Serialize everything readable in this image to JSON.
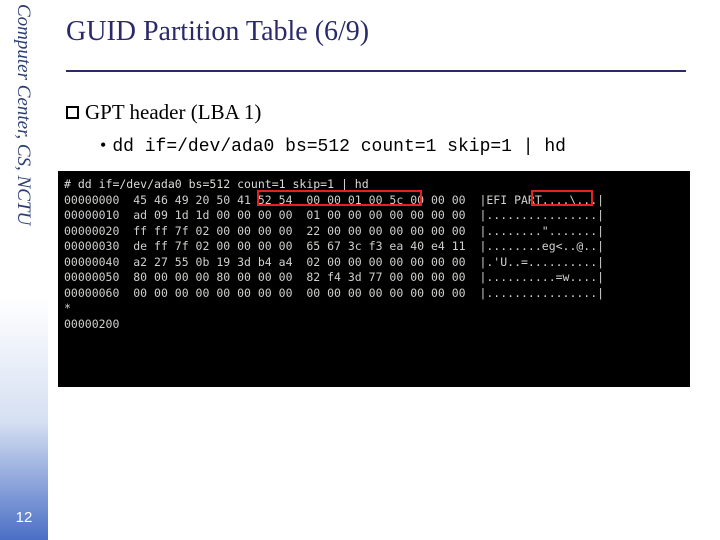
{
  "sidebar": {
    "org_text": "Computer Center, CS, NCTU",
    "page_number": "12"
  },
  "slide": {
    "title": "GUID Partition Table (6/9)",
    "section_heading": "GPT header (LBA 1)",
    "command": "dd if=/dev/ada0 bs=512 count=1 skip=1 | hd"
  },
  "hexdump": {
    "prompt": "# dd if=/dev/ada0 bs=512 count=1 skip=1 | hd",
    "rows": [
      {
        "off": "00000000",
        "hex": "45 46 49 20 50 41 52 54  00 00 01 00 5c 00 00 00",
        "ascii": "|EFI PART....\\...|"
      },
      {
        "off": "00000010",
        "hex": "ad 09 1d 1d 00 00 00 00  01 00 00 00 00 00 00 00",
        "ascii": "|................|"
      },
      {
        "off": "00000020",
        "hex": "ff ff 7f 02 00 00 00 00  22 00 00 00 00 00 00 00",
        "ascii": "|........\".......|"
      },
      {
        "off": "00000030",
        "hex": "de ff 7f 02 00 00 00 00  65 67 3c f3 ea 40 e4 11",
        "ascii": "|........eg<..@..|"
      },
      {
        "off": "00000040",
        "hex": "a2 27 55 0b 19 3d b4 a4  02 00 00 00 00 00 00 00",
        "ascii": "|.'U..=..........|"
      },
      {
        "off": "00000050",
        "hex": "80 00 00 00 80 00 00 00  82 f4 3d 77 00 00 00 00",
        "ascii": "|..........=w....|"
      },
      {
        "off": "00000060",
        "hex": "00 00 00 00 00 00 00 00  00 00 00 00 00 00 00 00",
        "ascii": "|................|"
      }
    ],
    "star": "*",
    "end": "00000200"
  }
}
